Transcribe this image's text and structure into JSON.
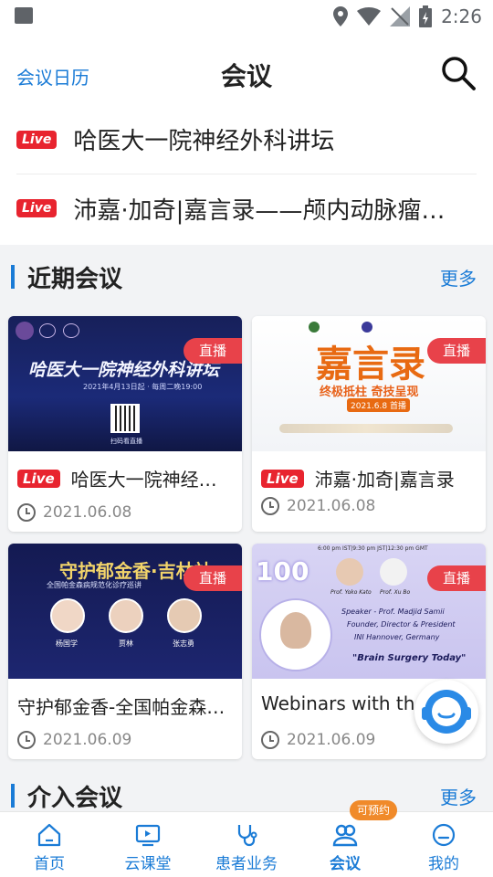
{
  "status_bar": {
    "time": "2:26"
  },
  "header": {
    "calendar_link": "会议日历",
    "title": "会议"
  },
  "live_list": [
    {
      "tag": "Live",
      "title": "哈医大一院神经外科讲坛"
    },
    {
      "tag": "Live",
      "title": "沛嘉·加奇|嘉言录——颅内动脉瘤介入治疗"
    }
  ],
  "recent_section": {
    "title": "近期会议",
    "more": "更多"
  },
  "cards": [
    {
      "badge": "直播",
      "live_tag": "Live",
      "title": "哈医大一院神经外科讲坛",
      "date": "2021.06.08",
      "thumb": {
        "headline": "哈医大一院神经外科讲坛",
        "sub": "2021年4月13日起 · 每周二晚19:00",
        "qr_caption": "扫码看直播"
      }
    },
    {
      "badge": "直播",
      "live_tag": "Live",
      "title": "沛嘉·加奇|嘉言录",
      "date": "2021.06.08",
      "thumb": {
        "headline": "嘉言录",
        "sub": "终极抵柱 奇技呈现",
        "sub2": "2021.6.8 首播"
      }
    },
    {
      "badge": "直播",
      "title": "守护郁金香-全国帕金森病巡讲吉林站",
      "date": "2021.06.09",
      "thumb": {
        "headline": "守护郁金香·吉林站",
        "sub": "全国帕金森病规范化诊疗巡讲",
        "names": [
          "杨国学",
          "贾林",
          "张志勇"
        ]
      }
    },
    {
      "badge": "直播",
      "title": "Webinars with the",
      "date": "2021.06.09",
      "thumb": {
        "number": "100",
        "time_line": "6:00 pm IST|9:30 pm JST|12:30 pm GMT",
        "speaker": "Speaker - Prof. Madjid Samii",
        "role": "Founder, Director & President",
        "org": "INI Hannover, Germany",
        "quote": "\"Brain Surgery Today\"",
        "prof_a": "Prof. Yoko Kato",
        "prof_b": "Prof. Xu Bo"
      }
    }
  ],
  "intervention_section": {
    "title": "介入会议",
    "more": "更多"
  },
  "tabbar": {
    "badge": "可预约",
    "tabs": [
      {
        "label": "首页",
        "icon": "home-icon"
      },
      {
        "label": "云课堂",
        "icon": "video-icon"
      },
      {
        "label": "患者业务",
        "icon": "stethoscope-icon"
      },
      {
        "label": "会议",
        "icon": "meeting-icon",
        "active": true
      },
      {
        "label": "我的",
        "icon": "profile-icon"
      }
    ]
  },
  "colors": {
    "accent": "#1a7bd6",
    "live_red": "#e8242f",
    "badge_orange": "#f08a2a"
  }
}
